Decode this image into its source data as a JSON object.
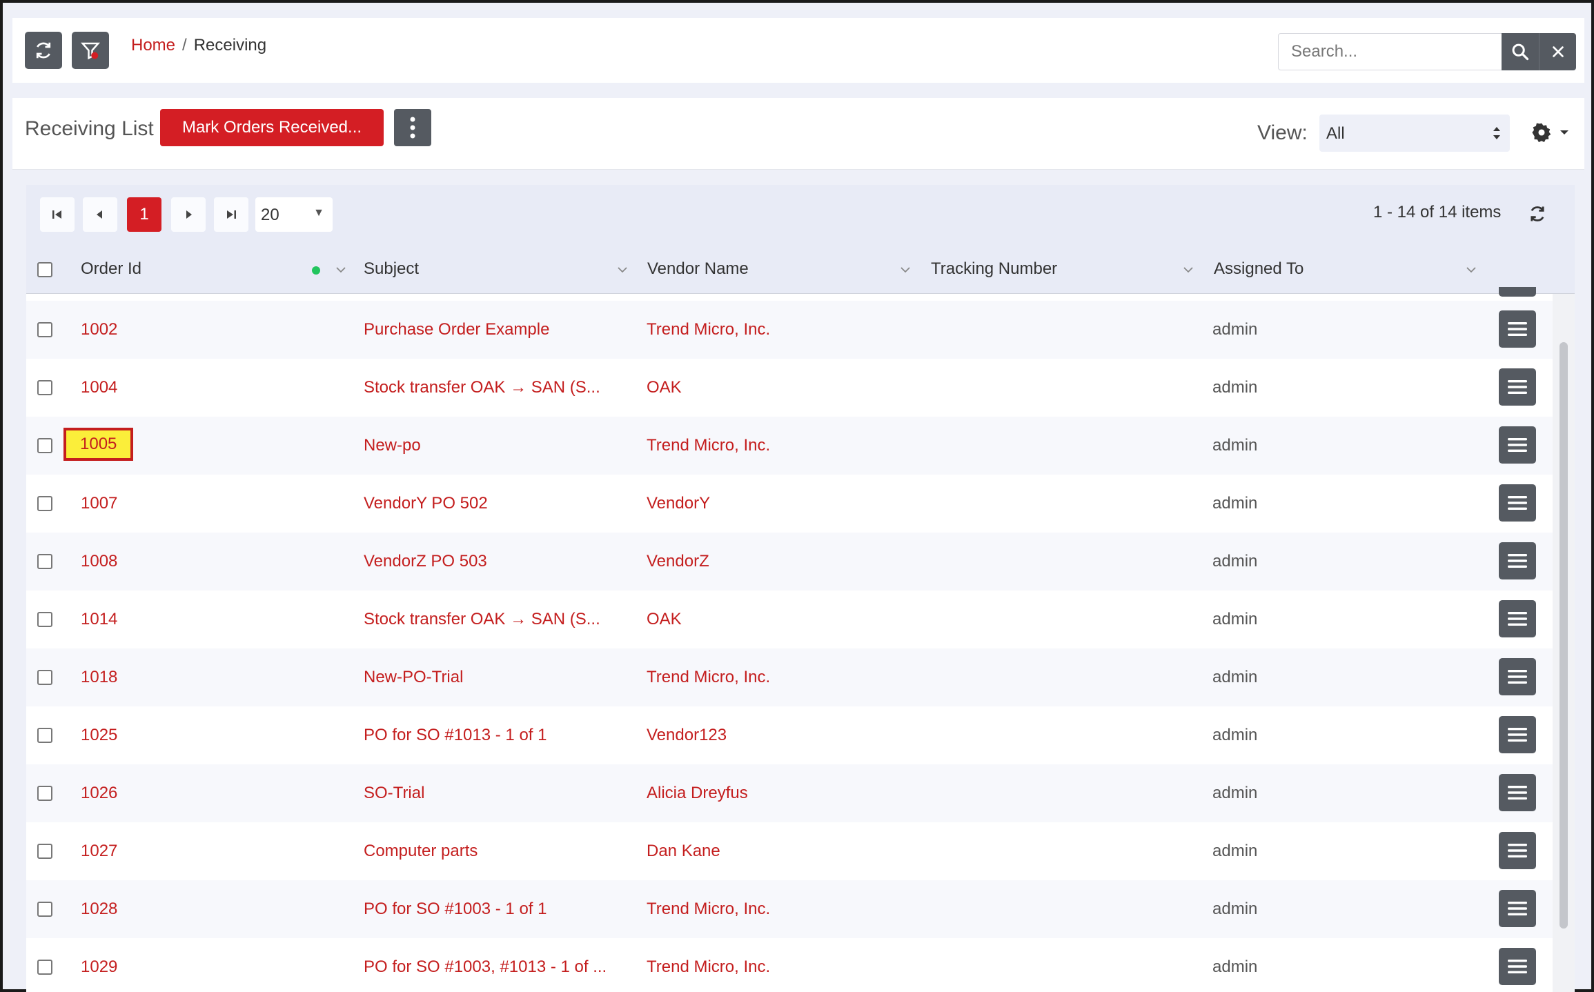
{
  "topbar": {
    "refresh_icon": "refresh-icon",
    "filter_icon": "filter-clear-icon",
    "breadcrumb": {
      "home": "Home",
      "separator": "/",
      "current": "Receiving"
    },
    "search": {
      "placeholder": "Search...",
      "value": ""
    }
  },
  "header": {
    "title": "Receiving List",
    "mark_button": "Mark Orders Received...",
    "view_label": "View:",
    "view_value": "All"
  },
  "pager": {
    "current_page": "1",
    "page_size": "20",
    "info": "1 - 14 of 14 items"
  },
  "columns": [
    "Order Id",
    "Subject",
    "Vendor Name",
    "Tracking Number",
    "Assigned To"
  ],
  "rows": [
    {
      "order_id": "1002",
      "subject": "Purchase Order Example",
      "vendor": "Trend Micro, Inc.",
      "tracking": "",
      "assigned": "admin"
    },
    {
      "order_id": "1004",
      "subject": "Stock transfer OAK → SAN (S...",
      "vendor": "OAK",
      "tracking": "",
      "assigned": "admin"
    },
    {
      "order_id": "1005",
      "subject": "New-po",
      "vendor": "Trend Micro, Inc.",
      "tracking": "",
      "assigned": "admin",
      "highlighted": true
    },
    {
      "order_id": "1007",
      "subject": "VendorY PO 502",
      "vendor": "VendorY",
      "tracking": "",
      "assigned": "admin"
    },
    {
      "order_id": "1008",
      "subject": "VendorZ PO 503",
      "vendor": "VendorZ",
      "tracking": "",
      "assigned": "admin"
    },
    {
      "order_id": "1014",
      "subject": "Stock transfer OAK → SAN (S...",
      "vendor": "OAK",
      "tracking": "",
      "assigned": "admin"
    },
    {
      "order_id": "1018",
      "subject": "New-PO-Trial",
      "vendor": "Trend Micro, Inc.",
      "tracking": "",
      "assigned": "admin"
    },
    {
      "order_id": "1025",
      "subject": "PO for SO #1013 - 1 of 1",
      "vendor": "Vendor123",
      "tracking": "",
      "assigned": "admin"
    },
    {
      "order_id": "1026",
      "subject": "SO-Trial",
      "vendor": "Alicia Dreyfus",
      "tracking": "",
      "assigned": "admin"
    },
    {
      "order_id": "1027",
      "subject": "Computer parts",
      "vendor": "Dan Kane",
      "tracking": "",
      "assigned": "admin"
    },
    {
      "order_id": "1028",
      "subject": "PO for SO #1003 - 1 of 1",
      "vendor": "Trend Micro, Inc.",
      "tracking": "",
      "assigned": "admin"
    },
    {
      "order_id": "1029",
      "subject": "PO for SO #1003, #1013 - 1 of ...",
      "vendor": "Trend Micro, Inc.",
      "tracking": "",
      "assigned": "admin"
    }
  ],
  "colors": {
    "accent_red": "#d41e24",
    "link_red": "#c41e1e",
    "button_gray": "#555a61",
    "highlight_yellow": "#fbee3a",
    "status_dot_green": "#22c55e"
  }
}
